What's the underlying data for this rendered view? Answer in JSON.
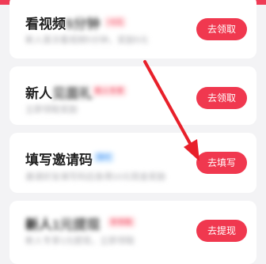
{
  "tasks": [
    {
      "title": "看视频",
      "title_blurred": "5分钟",
      "badge": "+5元",
      "subtitle": "新人首次看视频5分钟，奖励5元",
      "button": "去领取"
    },
    {
      "title": "新人",
      "title_blurred": "见面礼",
      "badge": "新人专享",
      "subtitle": "立即领取奖励",
      "button": "去领取"
    },
    {
      "title": "填写邀请码",
      "badge": "限时",
      "subtitle": "邀请好友填写码后各得10元现金奖励",
      "button": "去填写"
    },
    {
      "title": "新人",
      "title_blurred": "1元提现",
      "badge": "秒到账",
      "subtitle": "新人专享1元提现，立即领取",
      "button": "去提现"
    }
  ],
  "colors": {
    "accent": "#f0384f",
    "annotation_arrow": "#e8202a"
  }
}
